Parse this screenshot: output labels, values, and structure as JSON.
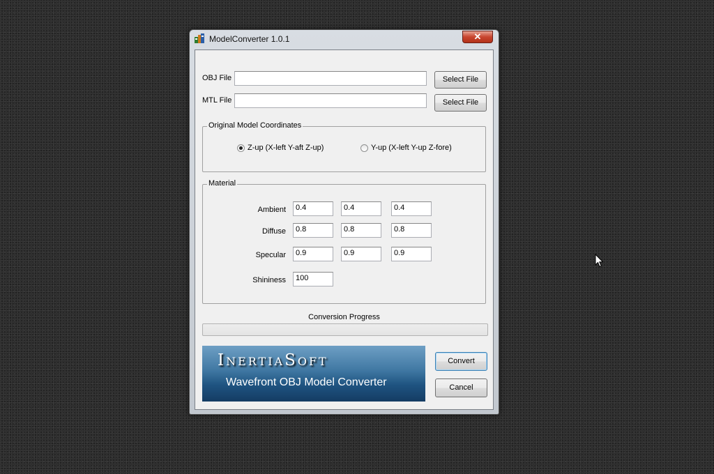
{
  "window": {
    "title": "ModelConverter 1.0.1",
    "close_label": "✕"
  },
  "files": {
    "obj_label": "OBJ File",
    "obj_value": "",
    "mtl_label": "MTL File",
    "mtl_value": "",
    "select_label": "Select File"
  },
  "coordinates": {
    "group_title": "Original Model Coordinates",
    "options": [
      {
        "label": "Z-up (X-left Y-aft Z-up)",
        "selected": true
      },
      {
        "label": "Y-up (X-left Y-up Z-fore)",
        "selected": false
      }
    ]
  },
  "material": {
    "group_title": "Material",
    "ambient": {
      "label": "Ambient",
      "values": [
        "0.4",
        "0.4",
        "0.4"
      ]
    },
    "diffuse": {
      "label": "Diffuse",
      "values": [
        "0.8",
        "0.8",
        "0.8"
      ]
    },
    "specular": {
      "label": "Specular",
      "values": [
        "0.9",
        "0.9",
        "0.9"
      ]
    },
    "shininess": {
      "label": "Shininess",
      "value": "100"
    }
  },
  "progress": {
    "label": "Conversion Progress",
    "value": 0
  },
  "banner": {
    "brand": "InertiaSoft",
    "subtitle": "Wavefront OBJ Model Converter"
  },
  "actions": {
    "convert_label": "Convert",
    "cancel_label": "Cancel"
  },
  "colors": {
    "progress_fill": "#06b025",
    "banner_top": "#6e9fc4",
    "banner_bottom": "#143c63"
  }
}
